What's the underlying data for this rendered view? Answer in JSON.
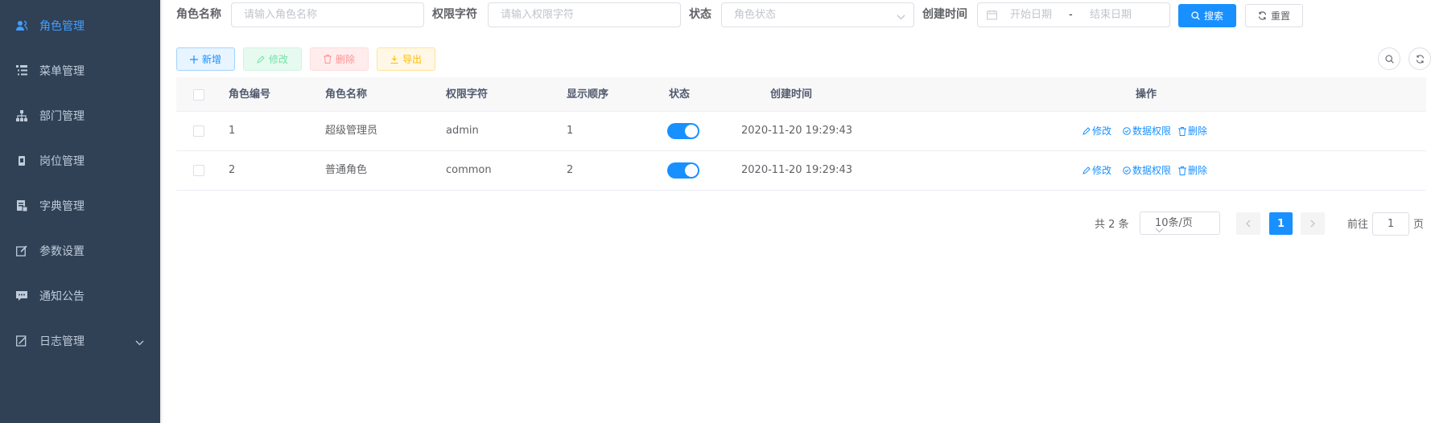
{
  "colors": {
    "sidebar_bg": "#304156",
    "sidebar_text": "#bfcbd9",
    "primary": "#1890ff",
    "active_menu": "#409eff"
  },
  "sidebar": {
    "items": [
      {
        "label": "角色管理",
        "icon": "user-role-icon",
        "active": true
      },
      {
        "label": "菜单管理",
        "icon": "tree-table-icon"
      },
      {
        "label": "部门管理",
        "icon": "org-tree-icon"
      },
      {
        "label": "岗位管理",
        "icon": "post-icon"
      },
      {
        "label": "字典管理",
        "icon": "dict-icon"
      },
      {
        "label": "参数设置",
        "icon": "edit-icon"
      },
      {
        "label": "通知公告",
        "icon": "message-icon"
      },
      {
        "label": "日志管理",
        "icon": "log-icon",
        "expandable": true
      }
    ]
  },
  "query": {
    "role_name_label": "角色名称",
    "role_name_placeholder": "请输入角色名称",
    "role_key_label": "权限字符",
    "role_key_placeholder": "请输入权限字符",
    "status_label": "状态",
    "status_placeholder": "角色状态",
    "created_label": "创建时间",
    "start_placeholder": "开始日期",
    "range_separator": "-",
    "end_placeholder": "结束日期",
    "search_button": "搜索",
    "reset_button": "重置"
  },
  "toolbar": {
    "add": "新增",
    "edit": "修改",
    "delete": "删除",
    "export": "导出"
  },
  "table": {
    "headers": [
      "角色编号",
      "角色名称",
      "权限字符",
      "显示顺序",
      "状态",
      "创建时间",
      "操作"
    ],
    "rows": [
      {
        "id": "1",
        "name": "超级管理员",
        "key": "admin",
        "sort": "1",
        "status": true,
        "created": "2020-11-20 19:29:43"
      },
      {
        "id": "2",
        "name": "普通角色",
        "key": "common",
        "sort": "2",
        "status": true,
        "created": "2020-11-20 19:29:43"
      }
    ],
    "actions": {
      "edit": "修改",
      "data_scope": "数据权限",
      "delete": "删除"
    }
  },
  "pagination": {
    "total_text": "共 2 条",
    "page_size": "10条/页",
    "current_page": "1",
    "goto_label": "前往",
    "goto_value": "1",
    "page_suffix": "页"
  }
}
